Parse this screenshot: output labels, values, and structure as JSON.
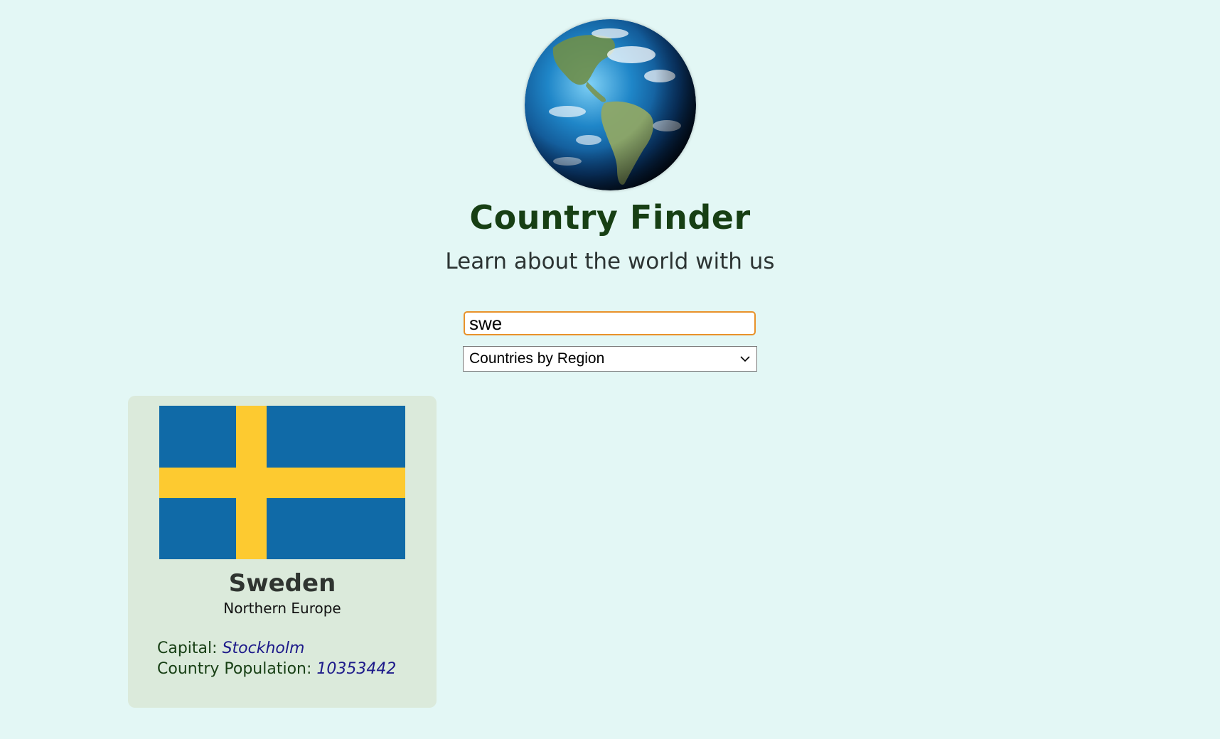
{
  "header": {
    "title": "Country Finder",
    "subtitle": "Learn about the world with us",
    "logo_icon": "globe-icon"
  },
  "search": {
    "value": "swe",
    "placeholder": ""
  },
  "filter": {
    "selected": "Countries by Region"
  },
  "results": [
    {
      "flag_icon": "sweden-flag",
      "flag_colors": {
        "field": "#106aa7",
        "cross": "#fdca30"
      },
      "name": "Sweden",
      "region": "Northern Europe",
      "capital_label": "Capital:",
      "capital": "Stockholm",
      "population_label": "Country Population:",
      "population": "10353442"
    }
  ],
  "colors": {
    "background": "#e3f7f5",
    "title": "#173f14",
    "search_focus_border": "#e8922a",
    "card_background": "#dbeadb",
    "value_text": "#1d1a8a"
  }
}
